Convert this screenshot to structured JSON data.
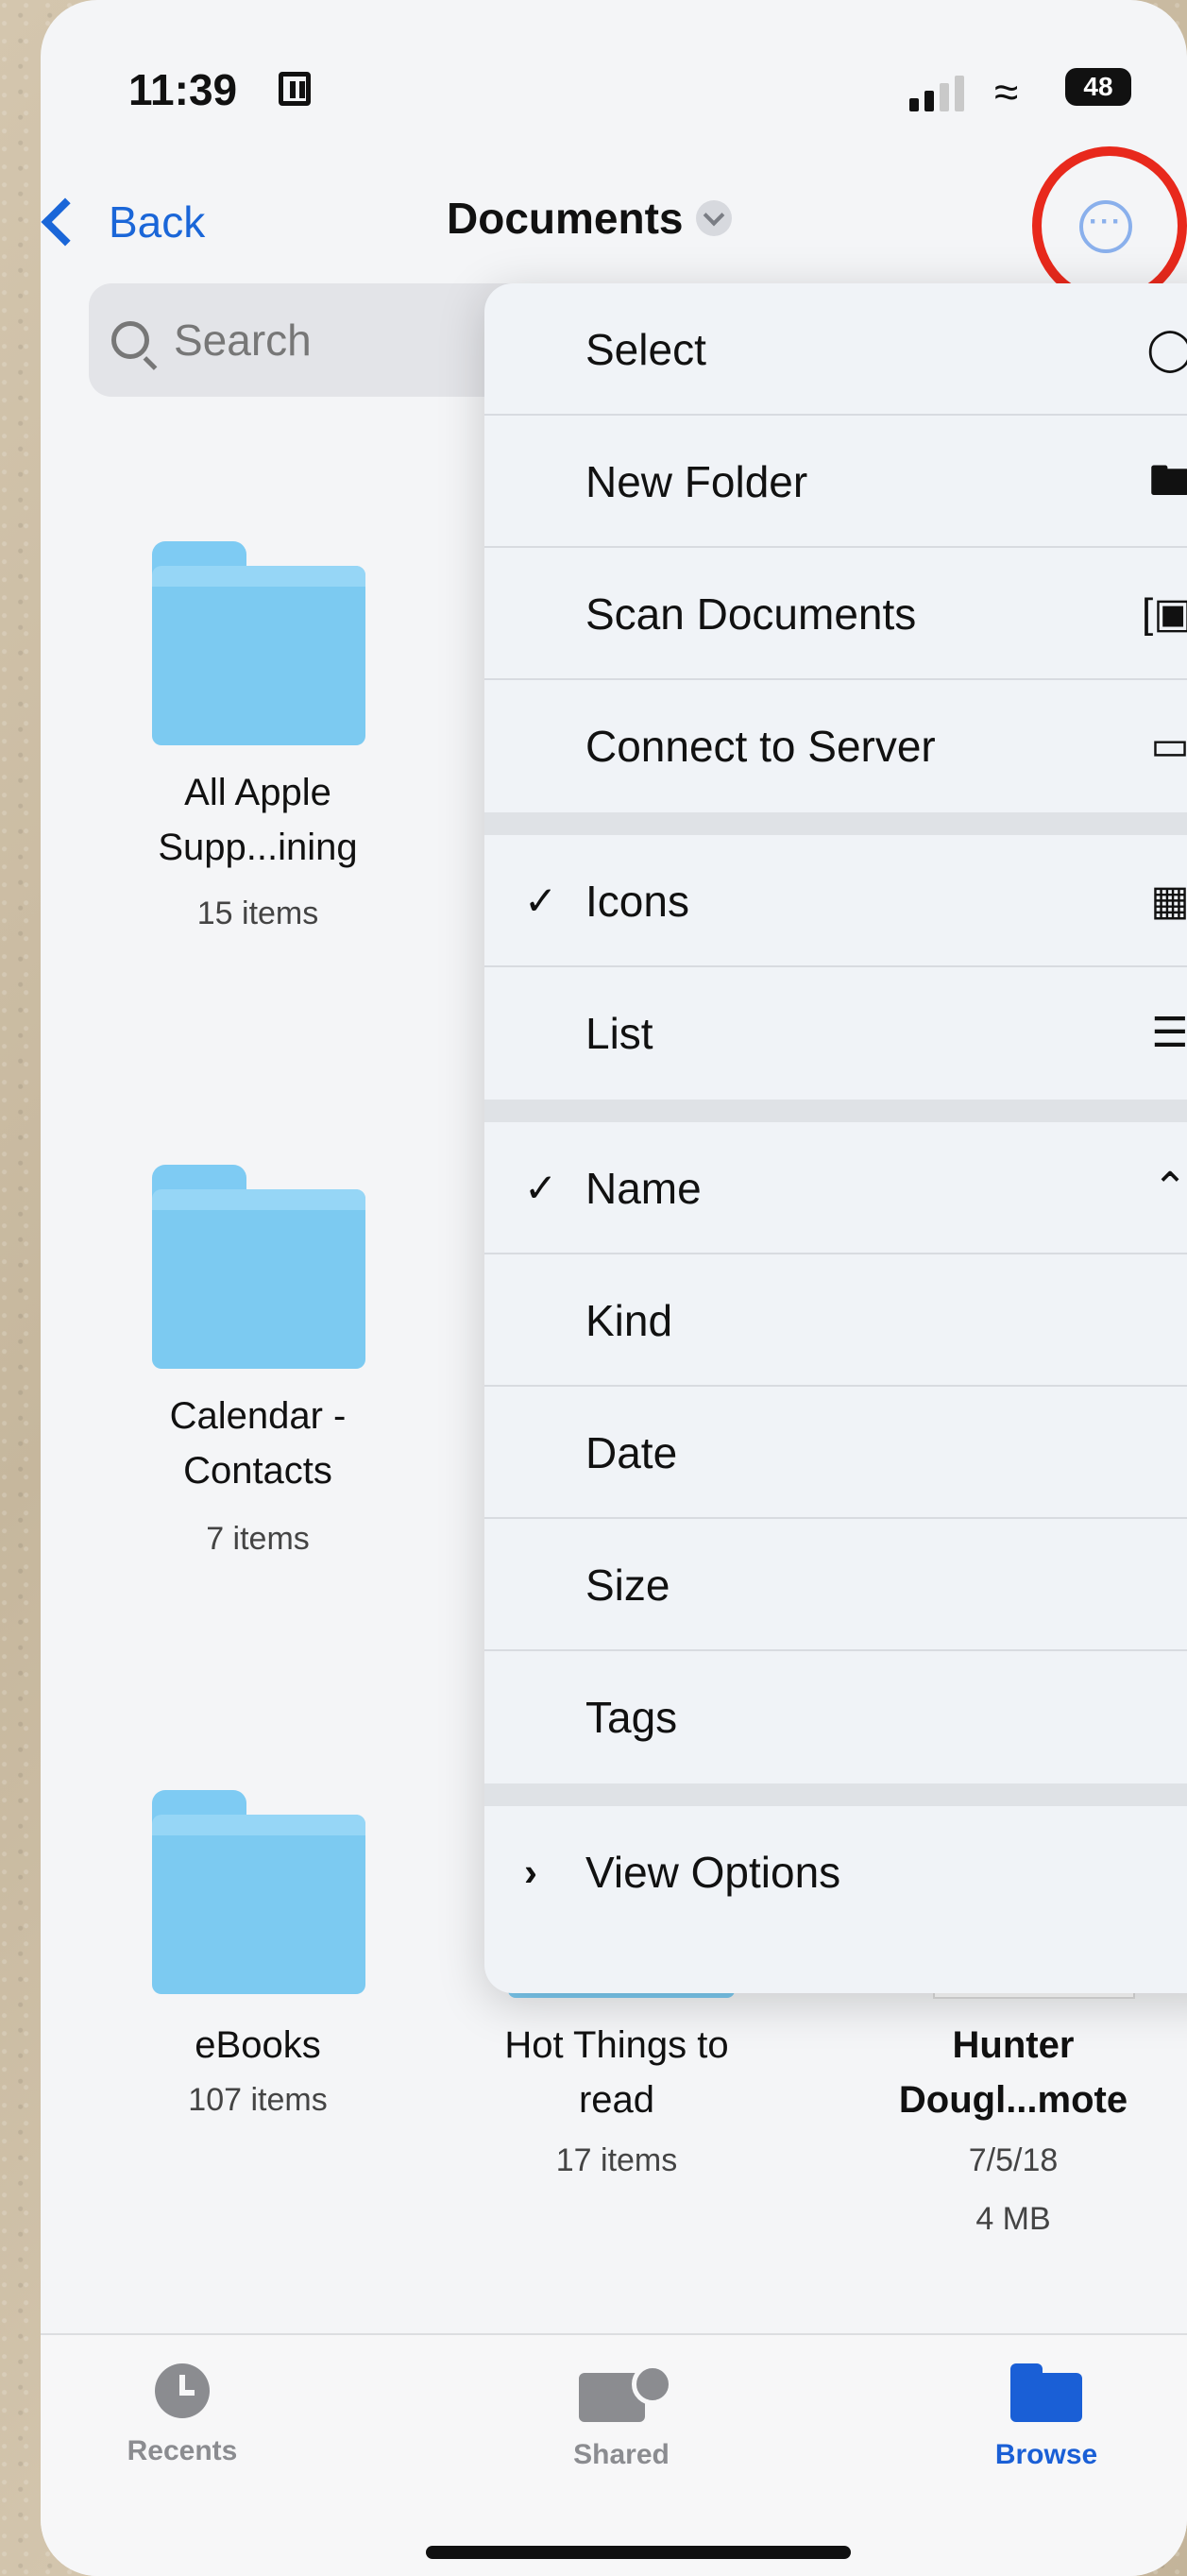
{
  "status_bar": {
    "time": "11:39",
    "battery": "48"
  },
  "nav": {
    "back_label": "Back",
    "title": "Documents"
  },
  "search": {
    "placeholder": "Search"
  },
  "folders": [
    {
      "name_line1": "All Apple",
      "name_line2": "Supp...ining",
      "meta": "15 items"
    },
    {
      "name_line1": "Calendar -",
      "name_line2": "Contacts",
      "meta": "7 items"
    },
    {
      "name_line1": "eBooks",
      "name_line2": "",
      "meta": "107 items"
    },
    {
      "name_line1": "Hot Things to",
      "name_line2": "read",
      "meta": "17 items"
    },
    {
      "name_line1": "Hunter",
      "name_line2": "Dougl...mote",
      "meta": "7/5/18",
      "size": "4 MB"
    }
  ],
  "menu": {
    "select": "Select",
    "new_folder": "New Folder",
    "scan_documents": "Scan Documents",
    "connect_to_server": "Connect to Server",
    "icons": "Icons",
    "list": "List",
    "name": "Name",
    "kind": "Kind",
    "date": "Date",
    "size": "Size",
    "tags": "Tags",
    "view_options": "View Options",
    "checked_view": "Icons",
    "checked_sort": "Name"
  },
  "tabbar": {
    "recents": "Recents",
    "shared": "Shared",
    "browse": "Browse",
    "active": "Browse",
    "active_color": "#1a5fd6",
    "inactive_color": "#8b8c90"
  },
  "highlight_color": "#e8291c"
}
